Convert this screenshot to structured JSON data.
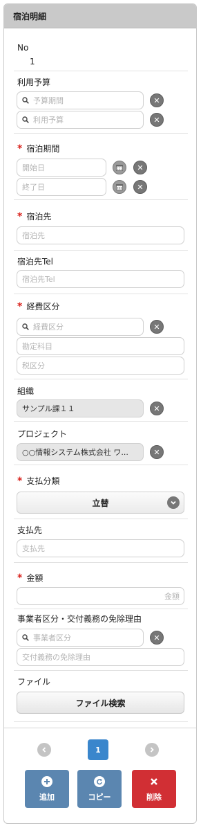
{
  "panel": {
    "title": "宿泊明細"
  },
  "no": {
    "label": "No",
    "value": "1"
  },
  "budget": {
    "label": "利用予算",
    "period_placeholder": "予算期間",
    "budget_placeholder": "利用予算"
  },
  "stay_period": {
    "label": "宿泊期間",
    "start_placeholder": "開始日",
    "end_placeholder": "終了日"
  },
  "stay_place": {
    "label": "宿泊先",
    "placeholder": "宿泊先"
  },
  "stay_tel": {
    "label": "宿泊先Tel",
    "placeholder": "宿泊先Tel"
  },
  "expense": {
    "label": "経費区分",
    "category_placeholder": "経費区分",
    "account_placeholder": "勘定科目",
    "tax_placeholder": "税区分"
  },
  "org": {
    "label": "組織",
    "value": "サンプル課１１"
  },
  "project": {
    "label": "プロジェクト",
    "value": "○○情報システム株式会社 ワ..."
  },
  "payment_type": {
    "label": "支払分類",
    "selected": "立替"
  },
  "payee": {
    "label": "支払先",
    "placeholder": "支払先"
  },
  "amount": {
    "label": "金額",
    "placeholder": "金額"
  },
  "business": {
    "label": "事業者区分・交付義務の免除理由",
    "category_placeholder": "事業者区分",
    "reason_placeholder": "交付義務の免除理由"
  },
  "file": {
    "label": "ファイル",
    "search_button": "ファイル検索"
  },
  "pager": {
    "current_page": "1"
  },
  "actions": {
    "add": "追加",
    "copy": "コピー",
    "delete": "削除"
  },
  "colors": {
    "required": "#d9231d",
    "page_active": "#3a86cc",
    "add_button": "#5b86b0",
    "copy_button": "#5b86b0",
    "delete_button": "#d12f34"
  },
  "icons": {
    "search": "magnifier-icon",
    "clear": "clear-x-icon",
    "calendar": "calendar-icon",
    "select": "chevron-down-icon",
    "prev": "chevron-left-icon",
    "next": "chevron-right-icon",
    "add": "plus-icon",
    "copy": "refresh-icon",
    "delete": "x-icon"
  }
}
